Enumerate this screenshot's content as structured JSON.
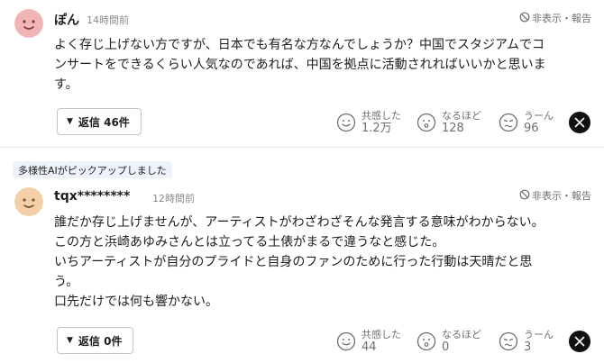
{
  "comments": [
    {
      "username": "ぽん",
      "time": "14時間前",
      "hide_report": "非表示・報告",
      "lines": [
        "よく存じ上げない方ですが、日本でも有名な方なんでしょうか？中国でスタジアムでコ",
        "ンサートをできるくらい人気なのであれば、中国を拠点に活動されればいいかと思いま",
        "す。"
      ],
      "reply_label": "返信 46件",
      "reactions": [
        {
          "label": "共感した",
          "count": "1.2万",
          "icon": "smile-face-icon"
        },
        {
          "label": "なるほど",
          "count": "128",
          "icon": "thinking-face-icon"
        },
        {
          "label": "うーん",
          "count": "96",
          "icon": "puzzled-face-icon"
        }
      ],
      "share_icon": "x-logo-icon",
      "avatar_color": "#f2b4b4"
    },
    {
      "ai_badge": "多様性AIがピックアップしました",
      "username": "tqx********",
      "time": "12時間前",
      "hide_report": "非表示・報告",
      "lines": [
        "誰だか存じ上げませんが、アーティストがわざわざそんな発言する意味がわからない。",
        "この方と浜崎あゆみさんとは立ってる土俵がまるで違うなと感じた。",
        "いちアーティストが自分のプライドと自身のファンのために行った行動は天晴だと思",
        "う。",
        "口先だけでは何も響かない。"
      ],
      "reply_label": "返信 0件",
      "reactions": [
        {
          "label": "共感した",
          "count": "44",
          "icon": "smile-face-icon"
        },
        {
          "label": "なるほど",
          "count": "0",
          "icon": "thinking-face-icon"
        },
        {
          "label": "うーん",
          "count": "3",
          "icon": "puzzled-face-icon"
        }
      ],
      "share_icon": "x-logo-icon",
      "avatar_color": "#f3cfa8"
    }
  ],
  "colors": {
    "text": "#1d1d1d",
    "muted": "#6f6f6f",
    "ai_badge_bg": "#eef3fb"
  }
}
